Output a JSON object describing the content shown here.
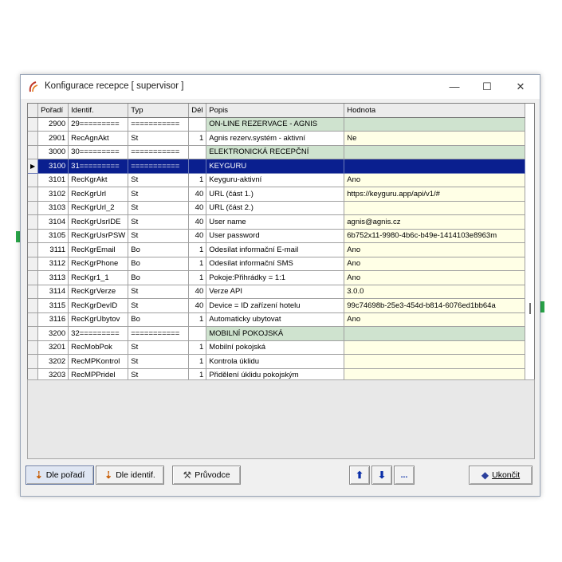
{
  "window": {
    "title": "Konfigurace recepce  [ supervisor ]",
    "minimize": "—",
    "maximize": "☐",
    "close": "✕"
  },
  "grid": {
    "columns": [
      "Pořadí",
      "Identif.",
      "Typ",
      "Dél",
      "Popis",
      "Hodnota"
    ],
    "rows": [
      {
        "poradi": "2900",
        "ident": "29=========",
        "typ": "===========",
        "del": "",
        "popis": "ON-LINE REZERVACE - AGNIS",
        "hodnota": "",
        "kind": "section"
      },
      {
        "poradi": "2901",
        "ident": "RecAgnAkt",
        "typ": "St",
        "del": "1",
        "popis": "Agnis rezerv.systém - aktivní",
        "hodnota": "Ne",
        "kind": "normal"
      },
      {
        "poradi": "3000",
        "ident": "30=========",
        "typ": "===========",
        "del": "",
        "popis": "ELEKTRONICKÁ RECEPČNÍ",
        "hodnota": "",
        "kind": "section"
      },
      {
        "poradi": "3100",
        "ident": "31=========",
        "typ": "===========",
        "del": "",
        "popis": "KEYGURU",
        "hodnota": "",
        "kind": "selected"
      },
      {
        "poradi": "3101",
        "ident": "RecKgrAkt",
        "typ": "St",
        "del": "1",
        "popis": "Keyguru-aktivní",
        "hodnota": "Ano",
        "kind": "normal"
      },
      {
        "poradi": "3102",
        "ident": "RecKgrUrl",
        "typ": "St",
        "del": "40",
        "popis": "URL (část 1.)",
        "hodnota": "https://keyguru.app/api/v1/#",
        "kind": "normal"
      },
      {
        "poradi": "3103",
        "ident": "RecKgrUrl_2",
        "typ": "St",
        "del": "40",
        "popis": "URL (část 2.)",
        "hodnota": "",
        "kind": "normal"
      },
      {
        "poradi": "3104",
        "ident": "RecKgrUsrIDE",
        "typ": "St",
        "del": "40",
        "popis": "User name",
        "hodnota": "agnis@agnis.cz",
        "kind": "normal"
      },
      {
        "poradi": "3105",
        "ident": "RecKgrUsrPSW",
        "typ": "St",
        "del": "40",
        "popis": "User password",
        "hodnota": "6b752x11-9980-4b6c-b49e-1414103e8963m",
        "kind": "normal"
      },
      {
        "poradi": "3111",
        "ident": "RecKgrEmail",
        "typ": "Bo",
        "del": "1",
        "popis": "Odesílat informační E-mail",
        "hodnota": "Ano",
        "kind": "normal"
      },
      {
        "poradi": "3112",
        "ident": "RecKgrPhone",
        "typ": "Bo",
        "del": "1",
        "popis": "Odesílat informační SMS",
        "hodnota": "Ano",
        "kind": "normal"
      },
      {
        "poradi": "3113",
        "ident": "RecKgr1_1",
        "typ": "Bo",
        "del": "1",
        "popis": "Pokoje:Přihrádky = 1:1",
        "hodnota": "Ano",
        "kind": "normal"
      },
      {
        "poradi": "3114",
        "ident": "RecKgrVerze",
        "typ": "St",
        "del": "40",
        "popis": "Verze API",
        "hodnota": "3.0.0",
        "kind": "normal"
      },
      {
        "poradi": "3115",
        "ident": "RecKgrDevID",
        "typ": "St",
        "del": "40",
        "popis": "Device = ID zařízení hotelu",
        "hodnota": "99c74698b-25e3-454d-b814-6076ed1bb64a",
        "kind": "normal"
      },
      {
        "poradi": "3116",
        "ident": "RecKgrUbytov",
        "typ": "Bo",
        "del": "1",
        "popis": "Automaticky ubytovat",
        "hodnota": "Ano",
        "kind": "normal"
      },
      {
        "poradi": "3200",
        "ident": "32=========",
        "typ": "===========",
        "del": "",
        "popis": "MOBILNÍ POKOJSKÁ",
        "hodnota": "",
        "kind": "section"
      },
      {
        "poradi": "3201",
        "ident": "RecMobPok",
        "typ": "St",
        "del": "1",
        "popis": "Mobilní pokojská",
        "hodnota": "",
        "kind": "normal"
      },
      {
        "poradi": "3202",
        "ident": "RecMPKontrol",
        "typ": "St",
        "del": "1",
        "popis": "Kontrola úklidu",
        "hodnota": "",
        "kind": "normal"
      },
      {
        "poradi": "3203",
        "ident": "RecMPPridel",
        "typ": "St",
        "del": "1",
        "popis": "Přidělení úklidu pokojským",
        "hodnota": "",
        "kind": "normal"
      }
    ]
  },
  "buttons": {
    "sort_order": "Dle pořadí",
    "sort_ident": "Dle identif.",
    "wizard": "Průvodce",
    "up": "⬆",
    "down": "⬇",
    "more": "...",
    "quit": "Ukončit"
  },
  "colors": {
    "section_row": "#cfe3cf",
    "selected_row": "#0a1f8f",
    "value_cell": "#ffffe6"
  }
}
